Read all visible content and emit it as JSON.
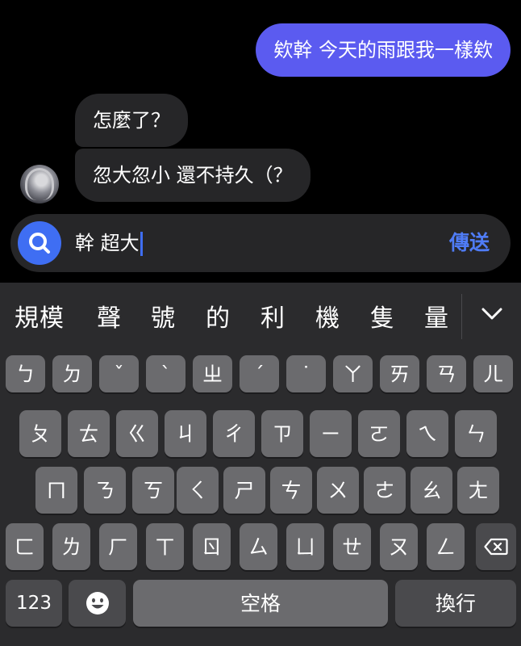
{
  "chat": {
    "outgoing": "欸幹 今天的雨跟我一樣欸",
    "incoming": [
      "怎麼了？",
      "忽大忽小 還不持久（？"
    ]
  },
  "composer": {
    "text": "幹 超大",
    "send_label": "傳送",
    "accent": "#3f6ef3"
  },
  "keyboard": {
    "candidates": [
      "規模",
      "聲",
      "號",
      "的",
      "利",
      "機",
      "隻",
      "量"
    ],
    "rows": [
      [
        "ㄅ",
        "ㄉ",
        "ˇ",
        "ˋ",
        "ㄓ",
        "ˊ",
        "˙",
        "ㄚ",
        "ㄞ",
        "ㄢ",
        "ㄦ"
      ],
      [
        "ㄆ",
        "ㄊ",
        "ㄍ",
        "ㄐ",
        "ㄔ",
        "ㄗ",
        "ㄧ",
        "ㄛ",
        "ㄟ",
        "ㄣ"
      ],
      [
        "ㄇ",
        "ㄋ",
        "ㄎ",
        "ㄑ",
        "ㄕ",
        "ㄘ",
        "ㄨ",
        "ㄜ",
        "ㄠ",
        "ㄤ"
      ],
      [
        "ㄈ",
        "ㄌ",
        "ㄏ",
        "ㄒ",
        "ㄖ",
        "ㄙ",
        "ㄩ",
        "ㄝ",
        "ㄡ",
        "ㄥ"
      ]
    ],
    "numbers_label": "123",
    "space_label": "空格",
    "return_label": "換行"
  }
}
